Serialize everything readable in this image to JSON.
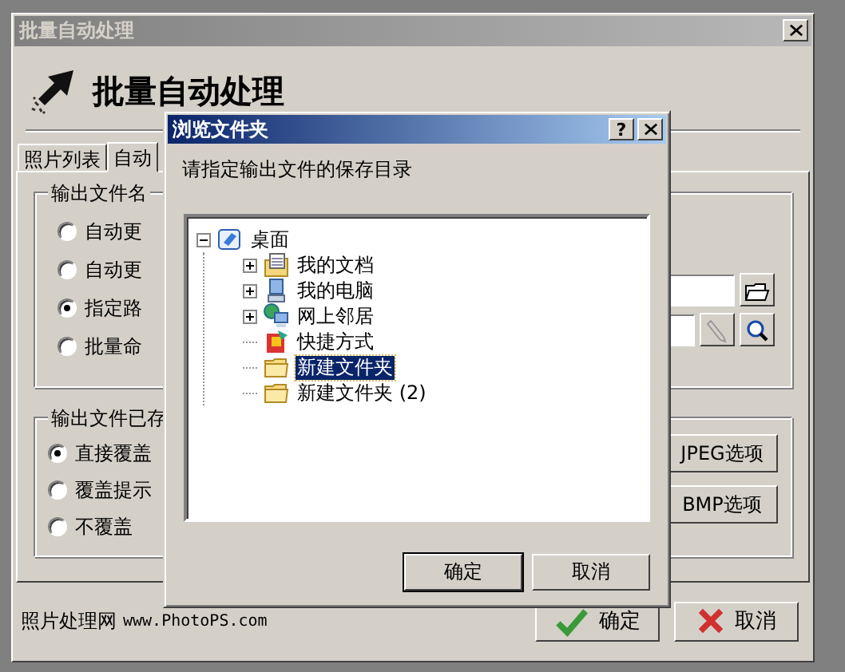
{
  "window": {
    "title": "批量自动处理"
  },
  "header": {
    "title": "批量自动处理"
  },
  "tabs": [
    {
      "label": "照片列表",
      "selected": false
    },
    {
      "label": "自动",
      "selected": true
    }
  ],
  "output_name": {
    "title": "输出文件名",
    "options": [
      {
        "label": "自动更",
        "selected": false
      },
      {
        "label": "自动更",
        "selected": false
      },
      {
        "label": "指定路",
        "selected": true
      },
      {
        "label": "批量命",
        "selected": false
      }
    ]
  },
  "existing_file": {
    "title": "输出文件已存",
    "options": [
      {
        "label": "直接覆盖",
        "selected": true
      },
      {
        "label": "覆盖提示",
        "selected": false
      },
      {
        "label": "不覆盖",
        "selected": false
      }
    ]
  },
  "format_buttons": [
    "JPEG选项",
    "BMP选项"
  ],
  "footer": {
    "site_name": "照片处理网",
    "site_url": "www.PhotoPS.com"
  },
  "buttons": [
    {
      "label": "确定",
      "kind": "ok"
    },
    {
      "label": "取消",
      "kind": "cancel"
    }
  ],
  "dialog": {
    "title": "浏览文件夹",
    "help": "?",
    "prompt": "请指定输出文件的保存目录",
    "tree": [
      {
        "label": "桌面",
        "kind": "desktop",
        "expandable": true,
        "expanded": true,
        "selected": false,
        "children": [
          {
            "label": "我的文档",
            "kind": "documents",
            "expandable": true,
            "expanded": false,
            "selected": false
          },
          {
            "label": "我的电脑",
            "kind": "computer",
            "expandable": true,
            "expanded": false,
            "selected": false
          },
          {
            "label": "网上邻居",
            "kind": "network",
            "expandable": true,
            "expanded": false,
            "selected": false
          },
          {
            "label": "快捷方式",
            "kind": "shortcut",
            "expandable": false,
            "selected": false
          },
          {
            "label": "新建文件夹",
            "kind": "folder",
            "expandable": false,
            "selected": true
          },
          {
            "label": "新建文件夹 (2)",
            "kind": "folder",
            "expandable": false,
            "selected": false
          }
        ]
      }
    ],
    "buttons": [
      {
        "label": "确定",
        "default": true
      },
      {
        "label": "取消",
        "default": false
      }
    ]
  }
}
